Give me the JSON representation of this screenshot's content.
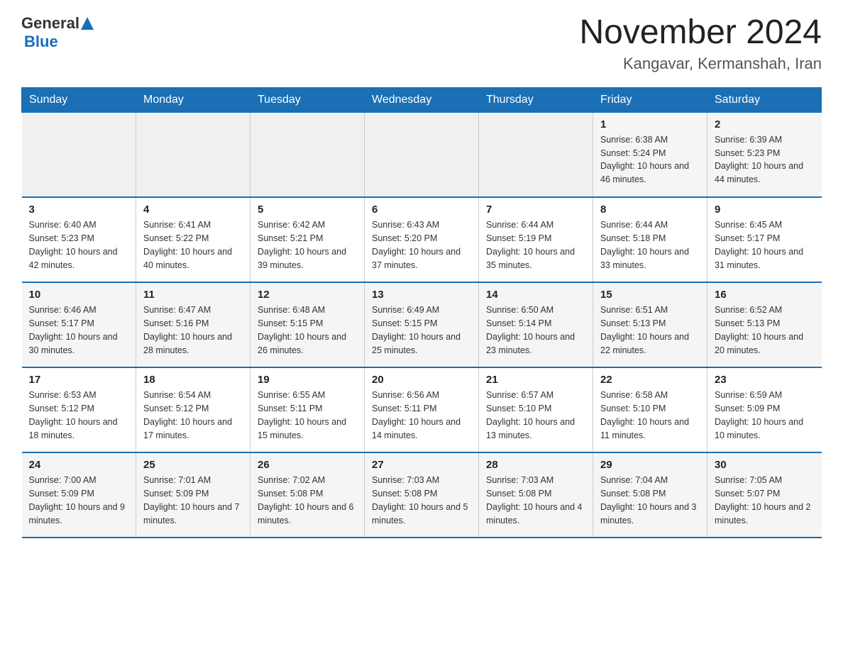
{
  "header": {
    "logo_general": "General",
    "logo_blue": "Blue",
    "month_year": "November 2024",
    "location": "Kangavar, Kermanshah, Iran"
  },
  "weekdays": [
    "Sunday",
    "Monday",
    "Tuesday",
    "Wednesday",
    "Thursday",
    "Friday",
    "Saturday"
  ],
  "weeks": [
    [
      {
        "day": "",
        "info": ""
      },
      {
        "day": "",
        "info": ""
      },
      {
        "day": "",
        "info": ""
      },
      {
        "day": "",
        "info": ""
      },
      {
        "day": "",
        "info": ""
      },
      {
        "day": "1",
        "info": "Sunrise: 6:38 AM\nSunset: 5:24 PM\nDaylight: 10 hours and 46 minutes."
      },
      {
        "day": "2",
        "info": "Sunrise: 6:39 AM\nSunset: 5:23 PM\nDaylight: 10 hours and 44 minutes."
      }
    ],
    [
      {
        "day": "3",
        "info": "Sunrise: 6:40 AM\nSunset: 5:23 PM\nDaylight: 10 hours and 42 minutes."
      },
      {
        "day": "4",
        "info": "Sunrise: 6:41 AM\nSunset: 5:22 PM\nDaylight: 10 hours and 40 minutes."
      },
      {
        "day": "5",
        "info": "Sunrise: 6:42 AM\nSunset: 5:21 PM\nDaylight: 10 hours and 39 minutes."
      },
      {
        "day": "6",
        "info": "Sunrise: 6:43 AM\nSunset: 5:20 PM\nDaylight: 10 hours and 37 minutes."
      },
      {
        "day": "7",
        "info": "Sunrise: 6:44 AM\nSunset: 5:19 PM\nDaylight: 10 hours and 35 minutes."
      },
      {
        "day": "8",
        "info": "Sunrise: 6:44 AM\nSunset: 5:18 PM\nDaylight: 10 hours and 33 minutes."
      },
      {
        "day": "9",
        "info": "Sunrise: 6:45 AM\nSunset: 5:17 PM\nDaylight: 10 hours and 31 minutes."
      }
    ],
    [
      {
        "day": "10",
        "info": "Sunrise: 6:46 AM\nSunset: 5:17 PM\nDaylight: 10 hours and 30 minutes."
      },
      {
        "day": "11",
        "info": "Sunrise: 6:47 AM\nSunset: 5:16 PM\nDaylight: 10 hours and 28 minutes."
      },
      {
        "day": "12",
        "info": "Sunrise: 6:48 AM\nSunset: 5:15 PM\nDaylight: 10 hours and 26 minutes."
      },
      {
        "day": "13",
        "info": "Sunrise: 6:49 AM\nSunset: 5:15 PM\nDaylight: 10 hours and 25 minutes."
      },
      {
        "day": "14",
        "info": "Sunrise: 6:50 AM\nSunset: 5:14 PM\nDaylight: 10 hours and 23 minutes."
      },
      {
        "day": "15",
        "info": "Sunrise: 6:51 AM\nSunset: 5:13 PM\nDaylight: 10 hours and 22 minutes."
      },
      {
        "day": "16",
        "info": "Sunrise: 6:52 AM\nSunset: 5:13 PM\nDaylight: 10 hours and 20 minutes."
      }
    ],
    [
      {
        "day": "17",
        "info": "Sunrise: 6:53 AM\nSunset: 5:12 PM\nDaylight: 10 hours and 18 minutes."
      },
      {
        "day": "18",
        "info": "Sunrise: 6:54 AM\nSunset: 5:12 PM\nDaylight: 10 hours and 17 minutes."
      },
      {
        "day": "19",
        "info": "Sunrise: 6:55 AM\nSunset: 5:11 PM\nDaylight: 10 hours and 15 minutes."
      },
      {
        "day": "20",
        "info": "Sunrise: 6:56 AM\nSunset: 5:11 PM\nDaylight: 10 hours and 14 minutes."
      },
      {
        "day": "21",
        "info": "Sunrise: 6:57 AM\nSunset: 5:10 PM\nDaylight: 10 hours and 13 minutes."
      },
      {
        "day": "22",
        "info": "Sunrise: 6:58 AM\nSunset: 5:10 PM\nDaylight: 10 hours and 11 minutes."
      },
      {
        "day": "23",
        "info": "Sunrise: 6:59 AM\nSunset: 5:09 PM\nDaylight: 10 hours and 10 minutes."
      }
    ],
    [
      {
        "day": "24",
        "info": "Sunrise: 7:00 AM\nSunset: 5:09 PM\nDaylight: 10 hours and 9 minutes."
      },
      {
        "day": "25",
        "info": "Sunrise: 7:01 AM\nSunset: 5:09 PM\nDaylight: 10 hours and 7 minutes."
      },
      {
        "day": "26",
        "info": "Sunrise: 7:02 AM\nSunset: 5:08 PM\nDaylight: 10 hours and 6 minutes."
      },
      {
        "day": "27",
        "info": "Sunrise: 7:03 AM\nSunset: 5:08 PM\nDaylight: 10 hours and 5 minutes."
      },
      {
        "day": "28",
        "info": "Sunrise: 7:03 AM\nSunset: 5:08 PM\nDaylight: 10 hours and 4 minutes."
      },
      {
        "day": "29",
        "info": "Sunrise: 7:04 AM\nSunset: 5:08 PM\nDaylight: 10 hours and 3 minutes."
      },
      {
        "day": "30",
        "info": "Sunrise: 7:05 AM\nSunset: 5:07 PM\nDaylight: 10 hours and 2 minutes."
      }
    ]
  ]
}
